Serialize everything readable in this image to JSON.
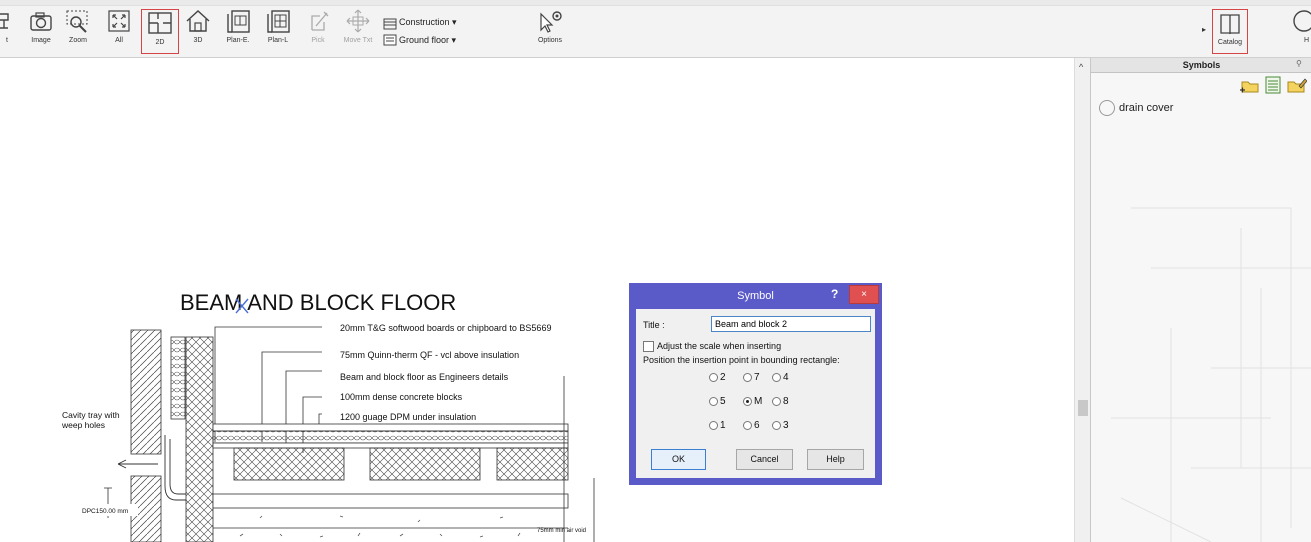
{
  "toolbar": {
    "buttons": [
      {
        "label": "t",
        "icon": "cutoff-icon"
      },
      {
        "label": "Image",
        "icon": "camera-icon"
      },
      {
        "label": "Zoom",
        "icon": "zoom-window-icon"
      },
      {
        "label": "All",
        "icon": "zoom-all-icon"
      },
      {
        "label": "2D",
        "icon": "plan-2d-icon",
        "selected": true
      },
      {
        "label": "3D",
        "icon": "house-3d-icon"
      },
      {
        "label": "Plan-E.",
        "icon": "plan-e-icon"
      },
      {
        "label": "Plan-L",
        "icon": "plan-l-icon"
      },
      {
        "label": "Pick",
        "icon": "pick-icon",
        "disabled": true
      },
      {
        "label": "Move Txt",
        "icon": "move-text-icon",
        "disabled": true
      },
      {
        "label": "Options",
        "icon": "options-cursor-icon"
      },
      {
        "label": "Catalog",
        "icon": "catalog-book-icon",
        "selected": true
      },
      {
        "label": "H",
        "icon": "help-circle-icon"
      }
    ],
    "construction_label": "Construction",
    "floor_label": "Ground floor"
  },
  "symbols_panel": {
    "title": "Symbols",
    "items": [
      {
        "name": "drain cover"
      }
    ]
  },
  "drawing": {
    "title": "BEAM AND BLOCK FLOOR",
    "notes": [
      "20mm T&G softwood boards or chipboard to BS5669",
      "75mm Quinn-therm QF - vcl above insulation",
      "Beam and block floor as Engineers details",
      "100mm dense concrete blocks",
      "1200 guage DPM under insulation"
    ],
    "cavity_label_1": "Cavity tray with",
    "cavity_label_2": "weep holes",
    "dpc_label": "DPC150.00 mm",
    "void_label": "75mm min air void"
  },
  "dialog": {
    "title": "Symbol",
    "help_glyph": "?",
    "close_glyph": "×",
    "title_field_label": "Title :",
    "title_field_value": "Beam and block 2",
    "adjust_scale_label": "Adjust the scale when inserting",
    "adjust_scale_checked": false,
    "position_label": "Position the insertion point in bounding rectangle:",
    "positions": [
      "2",
      "7",
      "4",
      "5",
      "M",
      "8",
      "1",
      "6",
      "3"
    ],
    "selected_position": "M",
    "ok_label": "OK",
    "cancel_label": "Cancel",
    "help_label": "Help"
  }
}
